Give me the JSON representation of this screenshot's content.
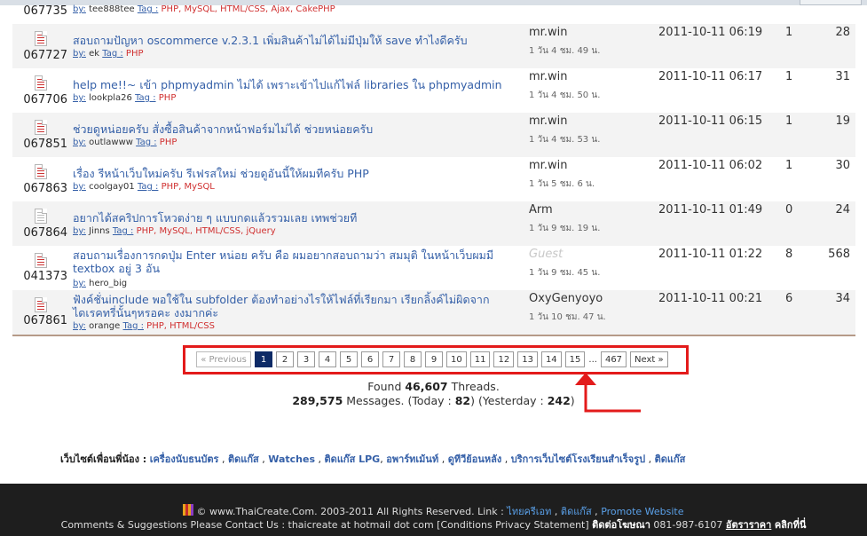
{
  "top_partial": {
    "id": "067735",
    "meta_by": "by:",
    "meta_user": "tee888tee",
    "meta_tag": "Tag :",
    "meta_tags": "PHP, MySQL, HTML/CSS, Ajax, CakePHP"
  },
  "threads": [
    {
      "id": "067727",
      "title": "สอบถามปัญหา oscommerce v.2.3.1 เพิ่มสินค้าไม่ได้ไม่มีปุ่มให้ save ทำไงดีครับ",
      "title2": "",
      "by": "by:",
      "user": "ek",
      "tag_label": "Tag :",
      "tags": "PHP",
      "author": "mr.win",
      "ago": "1 วัน 4 ชม. 49 น.",
      "date": "2011-10-11 06:19",
      "replies": "1",
      "views": "28",
      "icon": "red"
    },
    {
      "id": "067706",
      "title": "help me!!~ เข้า phpmyadmin ไม่ได้ เพราะเข้าไปแก้ไฟล์ libraries ใน phpmyadmin",
      "title2": "",
      "by": "by:",
      "user": "lookpla26",
      "tag_label": "Tag :",
      "tags": "PHP",
      "author": "mr.win",
      "ago": "1 วัน 4 ชม. 50 น.",
      "date": "2011-10-11 06:17",
      "replies": "1",
      "views": "31",
      "icon": "red"
    },
    {
      "id": "067851",
      "title": "ช่วยดูหน่อยครับ สั่งซื้อสินค้าจากหน้าฟอร์มไม่ได้ ช่วยหน่อยครับ",
      "title2": "",
      "by": "by:",
      "user": "outlawww",
      "tag_label": "Tag :",
      "tags": "PHP",
      "author": "mr.win",
      "ago": "1 วัน 4 ชม. 53 น.",
      "date": "2011-10-11 06:15",
      "replies": "1",
      "views": "19",
      "icon": "red"
    },
    {
      "id": "067863",
      "title": "เรื่อง รีหน้าเว็บใหม่ครับ รีเฟรสใหม่ ช่วยดูอันนี้ให้ผมทีครับ PHP",
      "title2": "",
      "by": "by:",
      "user": "coolgay01",
      "tag_label": "Tag :",
      "tags": "PHP, MySQL",
      "author": "mr.win",
      "ago": "1 วัน 5 ชม. 6 น.",
      "date": "2011-10-11 06:02",
      "replies": "1",
      "views": "30",
      "icon": "red"
    },
    {
      "id": "067864",
      "title": "อยากได้สคริปการโหวตง่าย ๆ แบบกดแล้วรวมเลย เทพช่วยที",
      "title2": "",
      "by": "by:",
      "user": "Jinns",
      "tag_label": "Tag :",
      "tags": "PHP, MySQL, HTML/CSS, jQuery",
      "author": "Arm",
      "ago": "1 วัน 9 ชม. 19 น.",
      "date": "2011-10-11 01:49",
      "replies": "0",
      "views": "24",
      "icon": "grey"
    },
    {
      "id": "041373",
      "title": "สอบถามเรื่องการกดปุ่ม Enter หน่อย ครับ คือ ผมอยากสอบถามว่า สมมุติ ในหน้าเว็บผมมี",
      "title2": "textbox อยู่ 3 อัน",
      "by": "by:",
      "user": "hero_big",
      "tag_label": "",
      "tags": "",
      "author": "Guest",
      "ago": "1 วัน 9 ชม. 45 น.",
      "date": "2011-10-11 01:22",
      "replies": "8",
      "views": "568",
      "icon": "red"
    },
    {
      "id": "067861",
      "title": "ฟังค์ชั่นinclude พอใช้ใน subfolder ต้องทำอย่างไรให้ไฟล์ที่เรียกมา เรียกลิ้งค์ไม่ผิดจาก",
      "title2": "ไดเรคทรี่นั้นๆหรอคะ งงมากค่ะ",
      "by": "by:",
      "user": "orange",
      "tag_label": "Tag :",
      "tags": "PHP, HTML/CSS",
      "author": "OxyGenyoyo",
      "ago": "1 วัน 10 ชม. 47 น.",
      "date": "2011-10-11 00:21",
      "replies": "6",
      "views": "34",
      "icon": "red"
    }
  ],
  "pagination": {
    "previous": "« Previous",
    "pages": [
      "1",
      "2",
      "3",
      "4",
      "5",
      "6",
      "7",
      "8",
      "9",
      "10",
      "11",
      "12",
      "13",
      "14",
      "15"
    ],
    "ellipsis": "...",
    "last": "467",
    "next": "Next »",
    "current": "1"
  },
  "summary": {
    "found_prefix": "Found",
    "found_count": "46,607",
    "found_suffix": "Threads.",
    "messages_count": "289,575",
    "messages_label": "Messages. (Today :",
    "today": "82",
    "yesterday_label": ") (Yesterday :",
    "yesterday": "242",
    "close": ")"
  },
  "friends": {
    "label": "เว็บไซต์เพื่อนพี่น้อง :",
    "links": [
      "เครื่องนับธนบัตร",
      "ติดแก๊ส",
      "Watches",
      "ติดแก๊ส LPG",
      "อพาร์ทเม้นท์",
      "ดูทีวีย้อนหลัง",
      "บริการเว็บไซต์โรงเรียนสำเร็จรูป",
      "ติดแก๊ส"
    ]
  },
  "footer": {
    "copyright": "© www.ThaiCreate.Com. 2003-2011 All Rights Reserved. Link :",
    "link1": "ไทยครีเอท",
    "link2": "ติดแก๊ส",
    "link3": "Promote Website",
    "contact": "Comments & Suggestions Please Contact Us : thaicreate at hotmail dot com [Conditions Privacy Statement]",
    "ads_label": "ติดต่อโฆษณา",
    "phone": "081-987-6107",
    "rates": "อัตราราคา",
    "click": "คลิกที่นี่"
  },
  "colors": {
    "link": "#3560a8",
    "tag": "#d03030",
    "highlight": "#e31b1b",
    "active_page": "#0d2a66",
    "footer_bg": "#1e1e1e"
  }
}
